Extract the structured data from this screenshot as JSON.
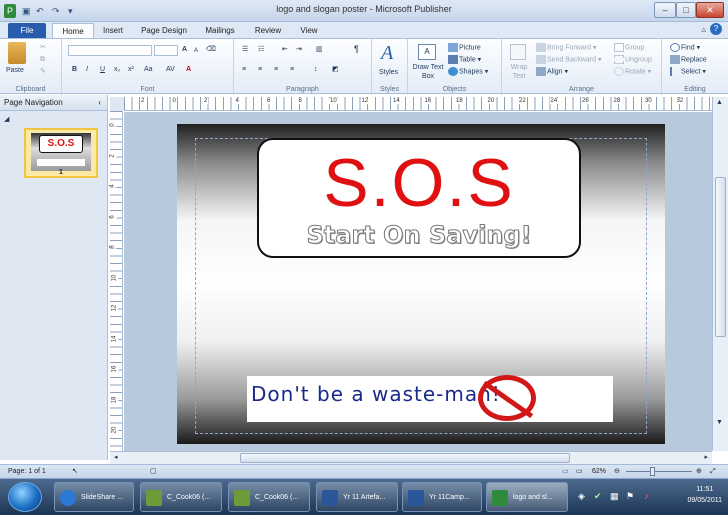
{
  "window": {
    "title": "logo and slogan poster - Microsoft Publisher",
    "app_icon": "publisher-icon",
    "quick_access": [
      "save-icon",
      "undo-icon",
      "redo-icon",
      "customize-icon"
    ]
  },
  "tabs": [
    "File",
    "Home",
    "Insert",
    "Page Design",
    "Mailings",
    "Review",
    "View"
  ],
  "active_tab": "Home",
  "ribbon": {
    "clipboard": {
      "paste": "Paste",
      "label": "Clipboard"
    },
    "font": {
      "label": "Font",
      "bold": "B",
      "italic": "I",
      "underline": "U",
      "grow": "A",
      "shrink": "A",
      "change_case": "Aa",
      "font_color": "A"
    },
    "paragraph": {
      "label": "Paragraph"
    },
    "styles": {
      "button": "Styles",
      "label": "Styles"
    },
    "objects": {
      "draw_text_box": "Draw Text Box",
      "picture": "Picture",
      "table": "Table",
      "shapes": "Shapes",
      "label": "Objects"
    },
    "arrange": {
      "wrap_text": "Wrap Text",
      "bring_forward": "Bring Forward",
      "send_backward": "Send Backward",
      "align": "Align",
      "group": "Group",
      "ungroup": "Ungroup",
      "rotate": "Rotate",
      "label": "Arrange"
    },
    "editing": {
      "find": "Find",
      "replace": "Replace",
      "select": "Select",
      "label": "Editing"
    }
  },
  "page_navigation": {
    "title": "Page Navigation",
    "page_number": "1"
  },
  "ruler": {
    "h_labels": [
      "2",
      "0",
      "2",
      "4",
      "6",
      "8",
      "10",
      "12",
      "14",
      "16",
      "18",
      "20",
      "22",
      "24",
      "26",
      "28",
      "30",
      "32"
    ],
    "v_labels": [
      "0",
      "2",
      "4",
      "6",
      "8",
      "10",
      "12",
      "14",
      "16",
      "18",
      "20"
    ]
  },
  "poster": {
    "logo_text": "S.O.S",
    "slogan": "Start On Saving!",
    "tagline": "Don't be a waste-man!"
  },
  "status": {
    "page": "Page: 1 of 1",
    "zoom": "62%"
  },
  "taskbar": {
    "items": [
      "SlideShare ...",
      "C_Cook06 (...",
      "C_Cook06 (...",
      "Yr 11 Artefa...",
      "Yr 11Camp...",
      "logo and sl..."
    ],
    "time": "11:51",
    "date": "09/05/2011"
  }
}
